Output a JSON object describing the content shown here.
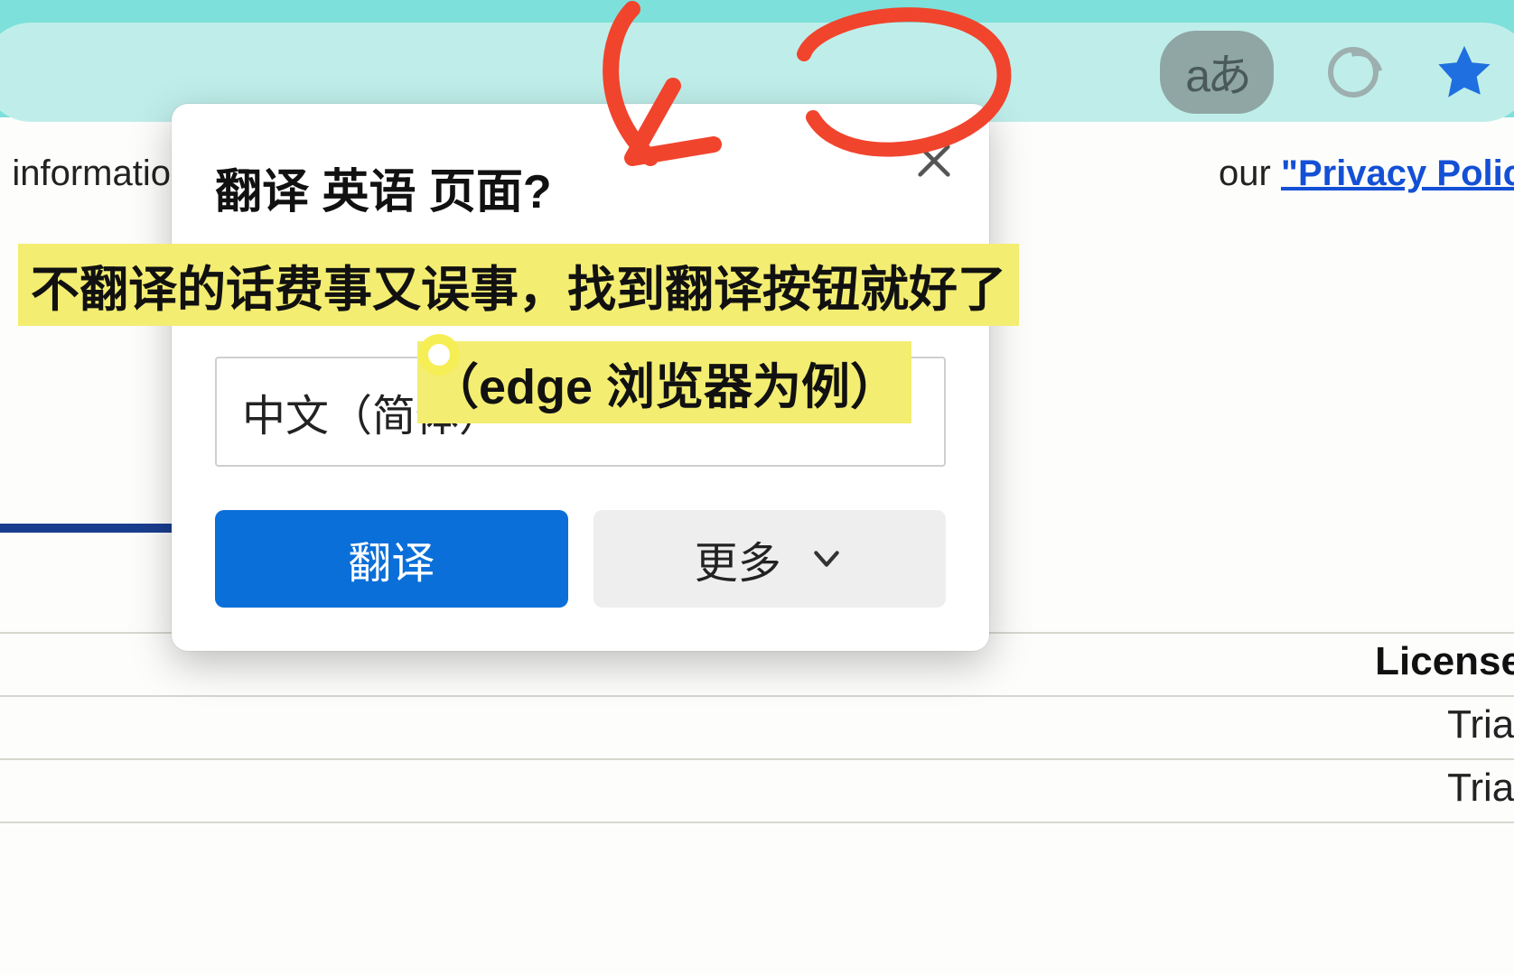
{
  "address_bar": {
    "translate_icon_glyph": "aあ"
  },
  "page": {
    "info_left_fragment": "d information",
    "info_right_prefix": " our ",
    "privacy_link_text": "\"Privacy Polic",
    "table_header": "License",
    "table_rows": [
      "Trial",
      "Trial"
    ]
  },
  "popup": {
    "title": "翻译 英语 页面?",
    "selected_language": "中文（简体）",
    "translate_button": "翻译",
    "more_button": "更多"
  },
  "annotations": {
    "line1": "不翻译的话费事又误事，找到翻译按钮就好了",
    "line2": "（edge 浏览器为例）"
  }
}
